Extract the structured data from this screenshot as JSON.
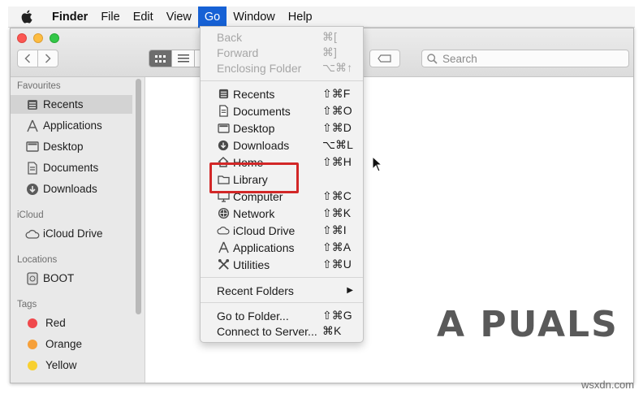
{
  "menubar": {
    "app": "Finder",
    "items": [
      "File",
      "Edit",
      "View",
      "Go",
      "Window",
      "Help"
    ],
    "active": "Go"
  },
  "toolbar": {
    "search_placeholder": "Search"
  },
  "sidebar": {
    "favourites_header": "Favourites",
    "favourites": [
      {
        "label": "Recents",
        "icon": "recents-icon"
      },
      {
        "label": "Applications",
        "icon": "applications-icon"
      },
      {
        "label": "Desktop",
        "icon": "desktop-icon"
      },
      {
        "label": "Documents",
        "icon": "documents-icon"
      },
      {
        "label": "Downloads",
        "icon": "downloads-icon"
      }
    ],
    "icloud_header": "iCloud",
    "icloud": [
      {
        "label": "iCloud Drive",
        "icon": "cloud-icon"
      }
    ],
    "locations_header": "Locations",
    "locations": [
      {
        "label": "BOOT",
        "icon": "disk-icon"
      }
    ],
    "tags_header": "Tags",
    "tags": [
      {
        "label": "Red",
        "color": "#f0484c"
      },
      {
        "label": "Orange",
        "color": "#f6a03a"
      },
      {
        "label": "Yellow",
        "color": "#f8d030"
      }
    ]
  },
  "go_menu": {
    "nav": [
      {
        "label": "Back",
        "shortcut": "⌘[",
        "enabled": false
      },
      {
        "label": "Forward",
        "shortcut": "⌘]",
        "enabled": false
      },
      {
        "label": "Enclosing Folder",
        "shortcut": "⌥⌘↑",
        "enabled": false
      }
    ],
    "places": [
      {
        "label": "Recents",
        "shortcut": "⇧⌘F",
        "icon": "recents-icon"
      },
      {
        "label": "Documents",
        "shortcut": "⇧⌘O",
        "icon": "documents-icon"
      },
      {
        "label": "Desktop",
        "shortcut": "⇧⌘D",
        "icon": "desktop-icon"
      },
      {
        "label": "Downloads",
        "shortcut": "⌥⌘L",
        "icon": "downloads-icon"
      },
      {
        "label": "Home",
        "shortcut": "⇧⌘H",
        "icon": "home-icon"
      },
      {
        "label": "Library",
        "shortcut": "",
        "icon": "folder-icon"
      },
      {
        "label": "Computer",
        "shortcut": "⇧⌘C",
        "icon": "computer-icon"
      },
      {
        "label": "Network",
        "shortcut": "⇧⌘K",
        "icon": "network-icon"
      },
      {
        "label": "iCloud Drive",
        "shortcut": "⇧⌘I",
        "icon": "cloud-icon"
      },
      {
        "label": "Applications",
        "shortcut": "⇧⌘A",
        "icon": "applications-icon"
      },
      {
        "label": "Utilities",
        "shortcut": "⇧⌘U",
        "icon": "utilities-icon"
      }
    ],
    "recent_folders": "Recent Folders",
    "go_to_folder": {
      "label": "Go to Folder...",
      "shortcut": "⇧⌘G"
    },
    "connect_to_server": {
      "label": "Connect to Server...",
      "shortcut": "⌘K"
    }
  },
  "watermark": "A  PUALS",
  "site": "wsxdn.com"
}
